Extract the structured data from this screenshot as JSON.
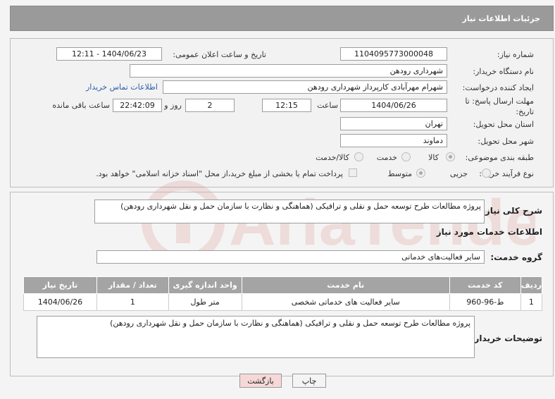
{
  "header": {
    "title": "جزئیات اطلاعات نیاز"
  },
  "form": {
    "need_number_label": "شماره نیاز:",
    "need_number": "1104095773000048",
    "announce_label": "تاریخ و ساعت اعلان عمومی:",
    "announce_value": "1404/06/23 - 12:11",
    "buyer_org_label": "نام دستگاه خریدار:",
    "buyer_org": "شهرداری رودهن",
    "creator_label": "ایجاد کننده درخواست:",
    "creator": "شهرام مهرآبادی کارپرداز شهرداری رودهن",
    "contact_link": "اطلاعات تماس خریدار",
    "deadline_label_1": "مهلت ارسال پاسخ: تا",
    "deadline_label_2": "تاریخ:",
    "deadline_date": "1404/06/26",
    "time_label": "ساعت",
    "deadline_time": "12:15",
    "days_value": "2",
    "days_label": "روز و",
    "remaining_time": "22:42:09",
    "remaining_label": "ساعت باقی مانده",
    "province_label": "استان محل تحویل:",
    "province": "تهران",
    "city_label": "شهر محل تحویل:",
    "city": "دماوند",
    "category_label": "طبقه بندی موضوعی:",
    "category_options": [
      "کالا",
      "خدمت",
      "کالا/خدمت"
    ],
    "process_label": "نوع فرآیند خرید :",
    "process_options": [
      "جزیی",
      "متوسط"
    ],
    "payment_note": "پرداخت تمام یا بخشی از مبلغ خرید،از محل \"اسناد خزانه اسلامی\" خواهد بود."
  },
  "summary": {
    "label": "شرح کلی نیاز:",
    "text": "پروژه مطالعات طرح توسعه حمل و نقلی و ترافیکی (هماهنگی و نظارت با سازمان حمل و نقل شهرداری رودهن)"
  },
  "services": {
    "title": "اطلاعات خدمات مورد نیاز",
    "group_label": "گروه خدمت:",
    "group_value": "سایر فعالیت‌های خدماتی",
    "columns": [
      "ردیف",
      "کد خدمت",
      "نام خدمت",
      "واحد اندازه گیری",
      "تعداد / مقدار",
      "تاریخ نیاز"
    ],
    "rows": [
      [
        "1",
        "ط-96-960",
        "سایر فعالیت های خدماتی شخصی",
        "متر طول",
        "1",
        "1404/06/26"
      ]
    ]
  },
  "buyer_notes": {
    "label": "توضیحات خریدار:",
    "text": "پروژه مطالعات طرح توسعه حمل و نقلی و ترافیکی (هماهنگی و نظارت با سازمان حمل و نقل شهرداری رودهن)"
  },
  "buttons": {
    "print": "چاپ",
    "back": "بازگشت"
  },
  "watermark": {
    "text": "AriaTender.neT",
    "color": "#c0392b"
  }
}
